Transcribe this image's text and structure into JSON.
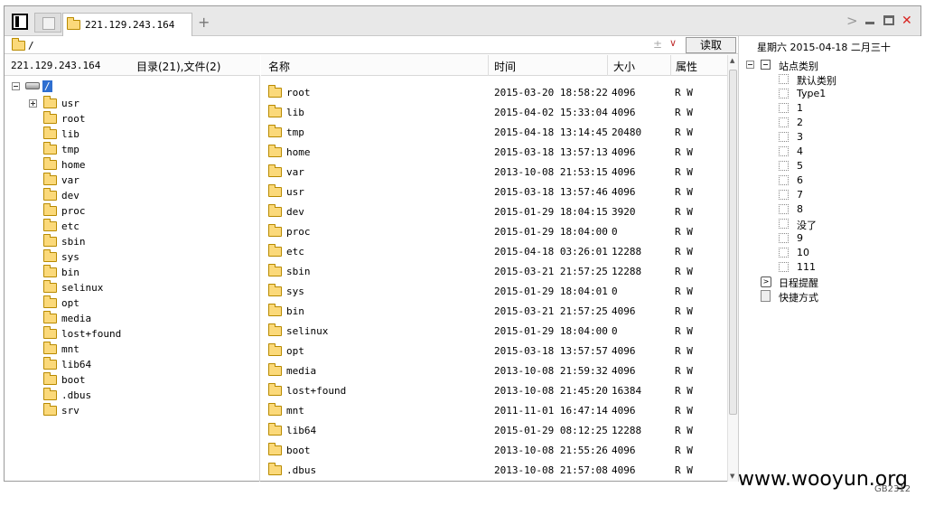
{
  "tab": {
    "title": "221.129.243.164"
  },
  "address": {
    "path": "/",
    "read_button": "读取"
  },
  "left": {
    "host": "221.129.243.164",
    "summary": "目录(21),文件(2)",
    "root_label": "/",
    "tree": [
      "usr",
      "root",
      "lib",
      "tmp",
      "home",
      "var",
      "dev",
      "proc",
      "etc",
      "sbin",
      "sys",
      "bin",
      "selinux",
      "opt",
      "media",
      "lost+found",
      "mnt",
      "lib64",
      "boot",
      ".dbus",
      "srv"
    ]
  },
  "columns": {
    "name": "名称",
    "time": "时间",
    "size": "大小",
    "attr": "属性"
  },
  "files": [
    {
      "name": "root",
      "time": "2015-03-20 18:58:22",
      "size": "4096",
      "attr": "R W"
    },
    {
      "name": "lib",
      "time": "2015-04-02 15:33:04",
      "size": "4096",
      "attr": "R W"
    },
    {
      "name": "tmp",
      "time": "2015-04-18 13:14:45",
      "size": "20480",
      "attr": "R W"
    },
    {
      "name": "home",
      "time": "2015-03-18 13:57:13",
      "size": "4096",
      "attr": "R W"
    },
    {
      "name": "var",
      "time": "2013-10-08 21:53:15",
      "size": "4096",
      "attr": "R W"
    },
    {
      "name": "usr",
      "time": "2015-03-18 13:57:46",
      "size": "4096",
      "attr": "R W"
    },
    {
      "name": "dev",
      "time": "2015-01-29 18:04:15",
      "size": "3920",
      "attr": "R W"
    },
    {
      "name": "proc",
      "time": "2015-01-29 18:04:00",
      "size": "0",
      "attr": "R W"
    },
    {
      "name": "etc",
      "time": "2015-04-18 03:26:01",
      "size": "12288",
      "attr": "R W"
    },
    {
      "name": "sbin",
      "time": "2015-03-21 21:57:25",
      "size": "12288",
      "attr": "R W"
    },
    {
      "name": "sys",
      "time": "2015-01-29 18:04:01",
      "size": "0",
      "attr": "R W"
    },
    {
      "name": "bin",
      "time": "2015-03-21 21:57:25",
      "size": "4096",
      "attr": "R W"
    },
    {
      "name": "selinux",
      "time": "2015-01-29 18:04:00",
      "size": "0",
      "attr": "R W"
    },
    {
      "name": "opt",
      "time": "2015-03-18 13:57:57",
      "size": "4096",
      "attr": "R W"
    },
    {
      "name": "media",
      "time": "2013-10-08 21:59:32",
      "size": "4096",
      "attr": "R W"
    },
    {
      "name": "lost+found",
      "time": "2013-10-08 21:45:20",
      "size": "16384",
      "attr": "R W"
    },
    {
      "name": "mnt",
      "time": "2011-11-01 16:47:14",
      "size": "4096",
      "attr": "R W"
    },
    {
      "name": "lib64",
      "time": "2015-01-29 08:12:25",
      "size": "12288",
      "attr": "R W"
    },
    {
      "name": "boot",
      "time": "2013-10-08 21:55:26",
      "size": "4096",
      "attr": "R W"
    },
    {
      "name": ".dbus",
      "time": "2013-10-08 21:57:08",
      "size": "4096",
      "attr": "R W"
    }
  ],
  "right": {
    "date": "星期六 2015-04-18 二月三十",
    "category_root": "站点类别",
    "categories": [
      "默认类别",
      "Type1",
      "1",
      "2",
      "3",
      "4",
      "5",
      "6",
      "7",
      "8",
      "没了",
      "9",
      "10",
      "111"
    ],
    "schedule": "日程提醒",
    "shortcuts": "快捷方式"
  },
  "watermark": "www.wooyun.org",
  "footer_tag": "GB2312"
}
